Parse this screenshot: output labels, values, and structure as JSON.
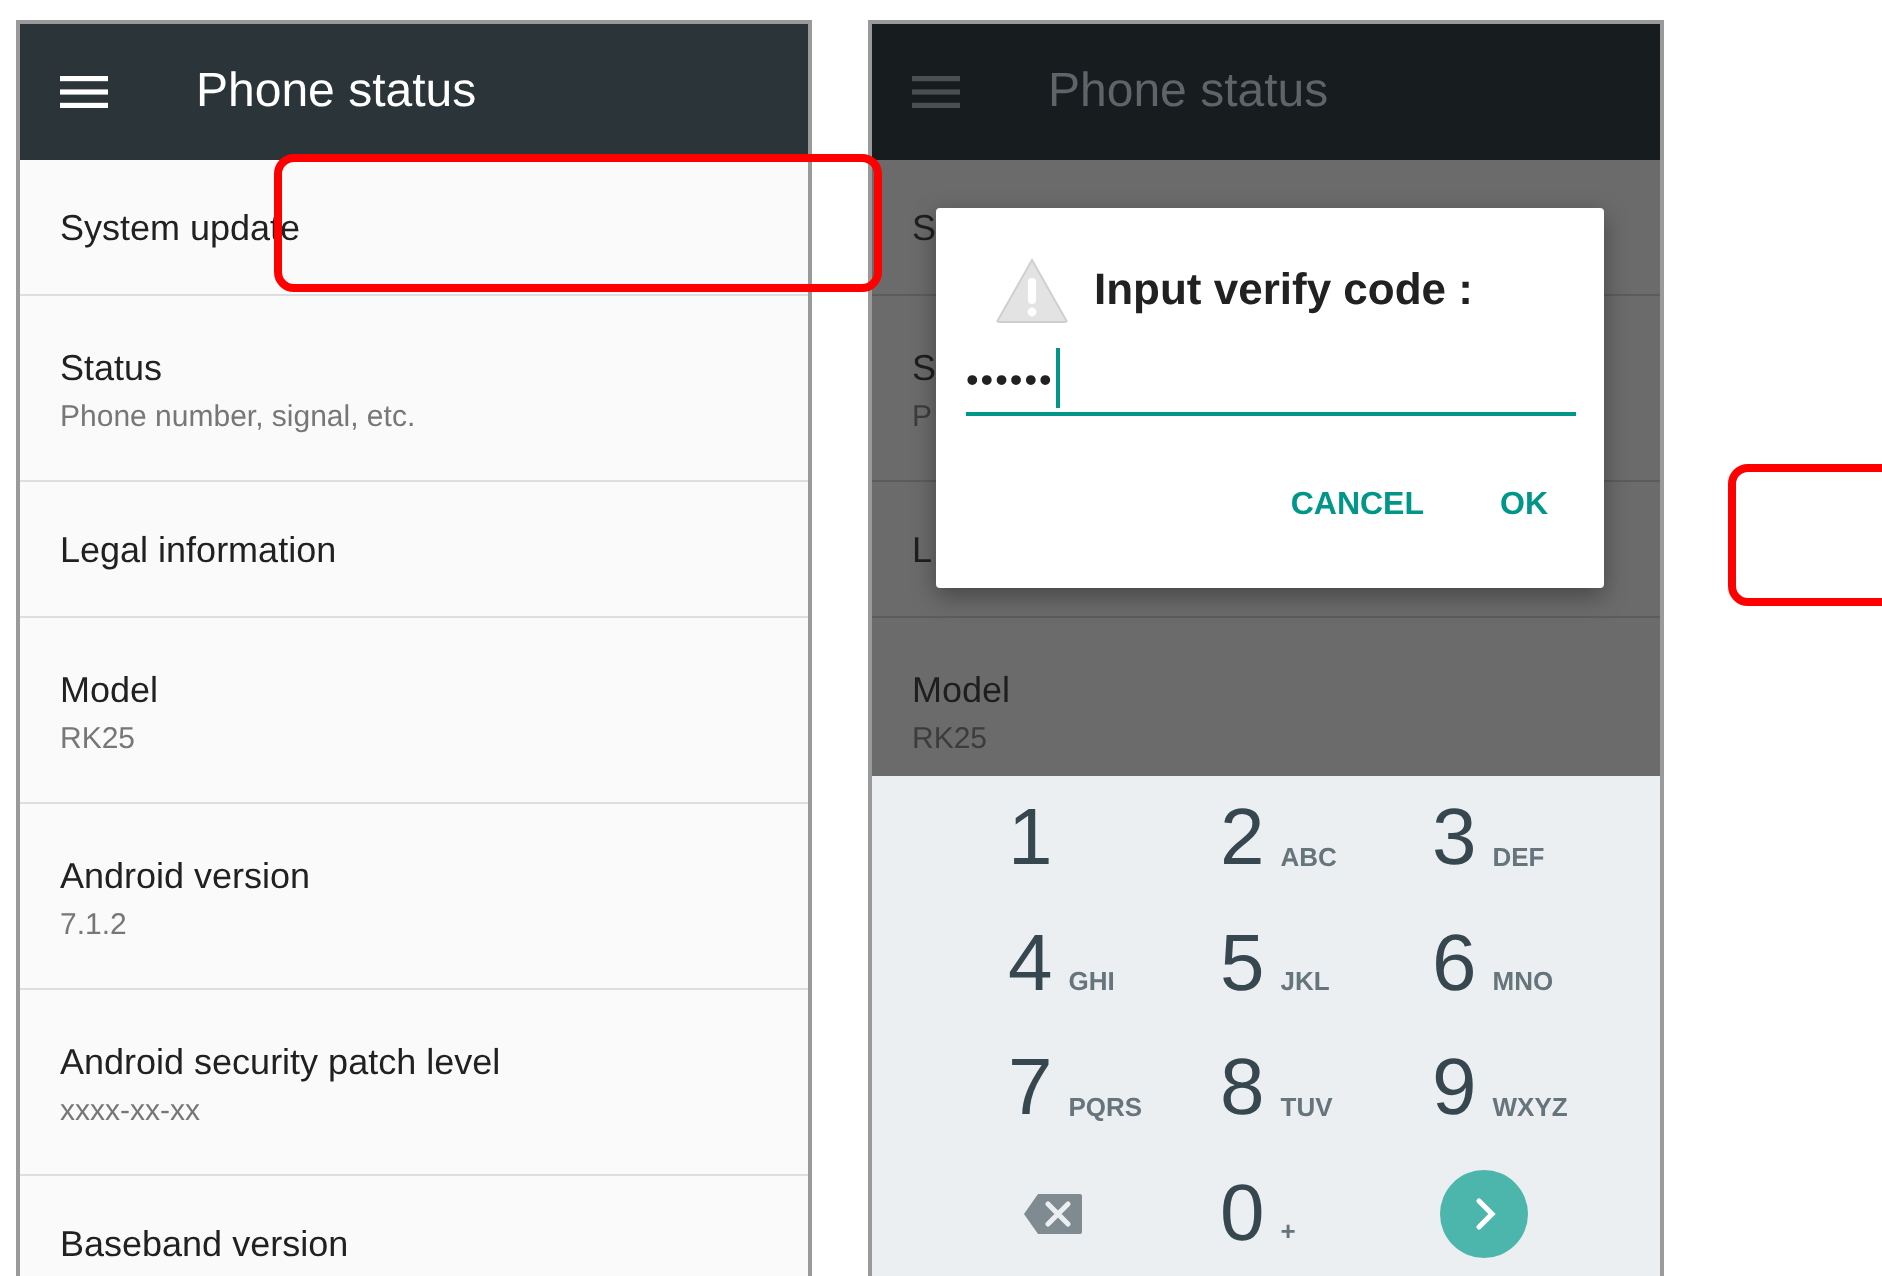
{
  "left_screen": {
    "title": "Phone status",
    "items": [
      {
        "title": "System update"
      },
      {
        "title": "Status",
        "summary": "Phone number, signal, etc."
      },
      {
        "title": "Legal information"
      },
      {
        "title": "Model",
        "summary": "RK25"
      },
      {
        "title": "Android version",
        "summary": "7.1.2"
      },
      {
        "title": "Android security patch level",
        "summary": "xxxx-xx-xx"
      },
      {
        "title": "Baseband version"
      }
    ]
  },
  "right_screen": {
    "title": "Phone status",
    "items": [
      {
        "title": "S"
      },
      {
        "title": "S",
        "summary": "P"
      },
      {
        "title": "L"
      },
      {
        "title": "Model",
        "summary": "RK25"
      }
    ],
    "dialog": {
      "title": "Input verify code :",
      "value": "••••••",
      "buttons": [
        "CANCEL",
        "OK"
      ]
    },
    "keypad": {
      "keys": [
        {
          "kind": "digit",
          "digit": "1"
        },
        {
          "kind": "digit",
          "digit": "2",
          "letters": "ABC"
        },
        {
          "kind": "digit",
          "digit": "3",
          "letters": "DEF"
        },
        {
          "kind": "digit",
          "digit": "4",
          "letters": "GHI"
        },
        {
          "kind": "digit",
          "digit": "5",
          "letters": "JKL"
        },
        {
          "kind": "digit",
          "digit": "6",
          "letters": "MNO"
        },
        {
          "kind": "digit",
          "digit": "7",
          "letters": "PQRS"
        },
        {
          "kind": "digit",
          "digit": "8",
          "letters": "TUV"
        },
        {
          "kind": "digit",
          "digit": "9",
          "letters": "WXYZ"
        },
        {
          "kind": "backspace"
        },
        {
          "kind": "digit",
          "digit": "0",
          "letters": "+"
        },
        {
          "kind": "go"
        }
      ]
    }
  }
}
